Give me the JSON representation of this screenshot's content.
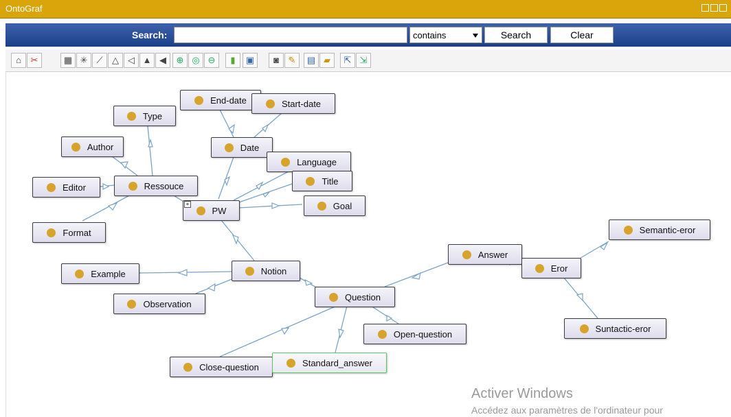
{
  "window": {
    "title": "OntoGraf"
  },
  "search": {
    "label": "Search:",
    "value": "",
    "mode": "contains",
    "search_button": "Search",
    "clear_button": "Clear"
  },
  "toolbar": {
    "icons": [
      "home-icon",
      "remove-icon",
      "grid-layout-icon",
      "radial-layout-icon",
      "spring-layout-icon",
      "tree-down-icon",
      "tree-left-icon",
      "vertical-tree-icon",
      "horizontal-tree-icon",
      "zoom-in-icon",
      "zoom-fit-icon",
      "zoom-out-icon",
      "filter-icon",
      "export-icon",
      "camera-icon",
      "edit-icon",
      "save-icon",
      "open-folder-icon",
      "import-icon",
      "export-graph-icon"
    ]
  },
  "nodes": {
    "end_date": "End-date",
    "start_date": "Start-date",
    "type": "Type",
    "date": "Date",
    "author": "Author",
    "language": "Language",
    "title": "Title",
    "editor": "Editor",
    "ressouce": "Ressouce",
    "goal": "Goal",
    "pw": "PW",
    "format": "Format",
    "semantic_eror": "Semantic-eror",
    "answer": "Answer",
    "eror": "Eror",
    "example": "Example",
    "notion": "Notion",
    "question": "Question",
    "observation": "Observation",
    "open_question": "Open-question",
    "suntactic_eror": "Suntactic-eror",
    "close_question": "Close-question",
    "standard_answer": "Standard_answer"
  },
  "watermark": {
    "line1": "Activer Windows",
    "line2": "Accédez aux paramètres de l'ordinateur pour"
  }
}
